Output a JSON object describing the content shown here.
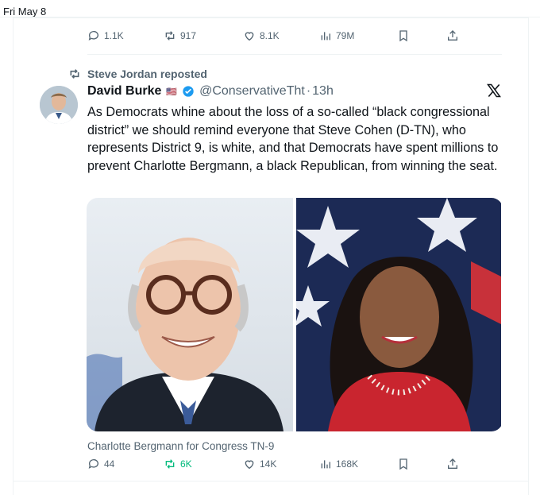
{
  "date_label": "Fri May 8",
  "colors": {
    "accent": "#1d9bf0",
    "muted": "#536471",
    "repost_green": "#00ba7c",
    "divider": "#eff3f4"
  },
  "top_actions": {
    "replies": "1.1K",
    "reposts": "917",
    "likes": "8.1K",
    "views": "79M"
  },
  "repost": {
    "icon": "repost-icon",
    "text": "Steve Jordan reposted"
  },
  "tweet": {
    "author_name": "David Burke",
    "flag": "🇺🇸",
    "handle": "@ConservativeTht",
    "dot": "·",
    "time": "13h",
    "text": "As Democrats whine about the loss of a so-called “black congressional district” we should remind everyone that Steve Cohen (D-TN), who represents District 9, is white, and that Democrats have spent millions to prevent Charlotte Bergmann, a black Republican, from winning the seat.",
    "media_caption": "Charlotte Bergmann for Congress TN-9",
    "actions": {
      "replies": "44",
      "reposts": "6K",
      "likes": "14K",
      "views": "168K"
    }
  }
}
